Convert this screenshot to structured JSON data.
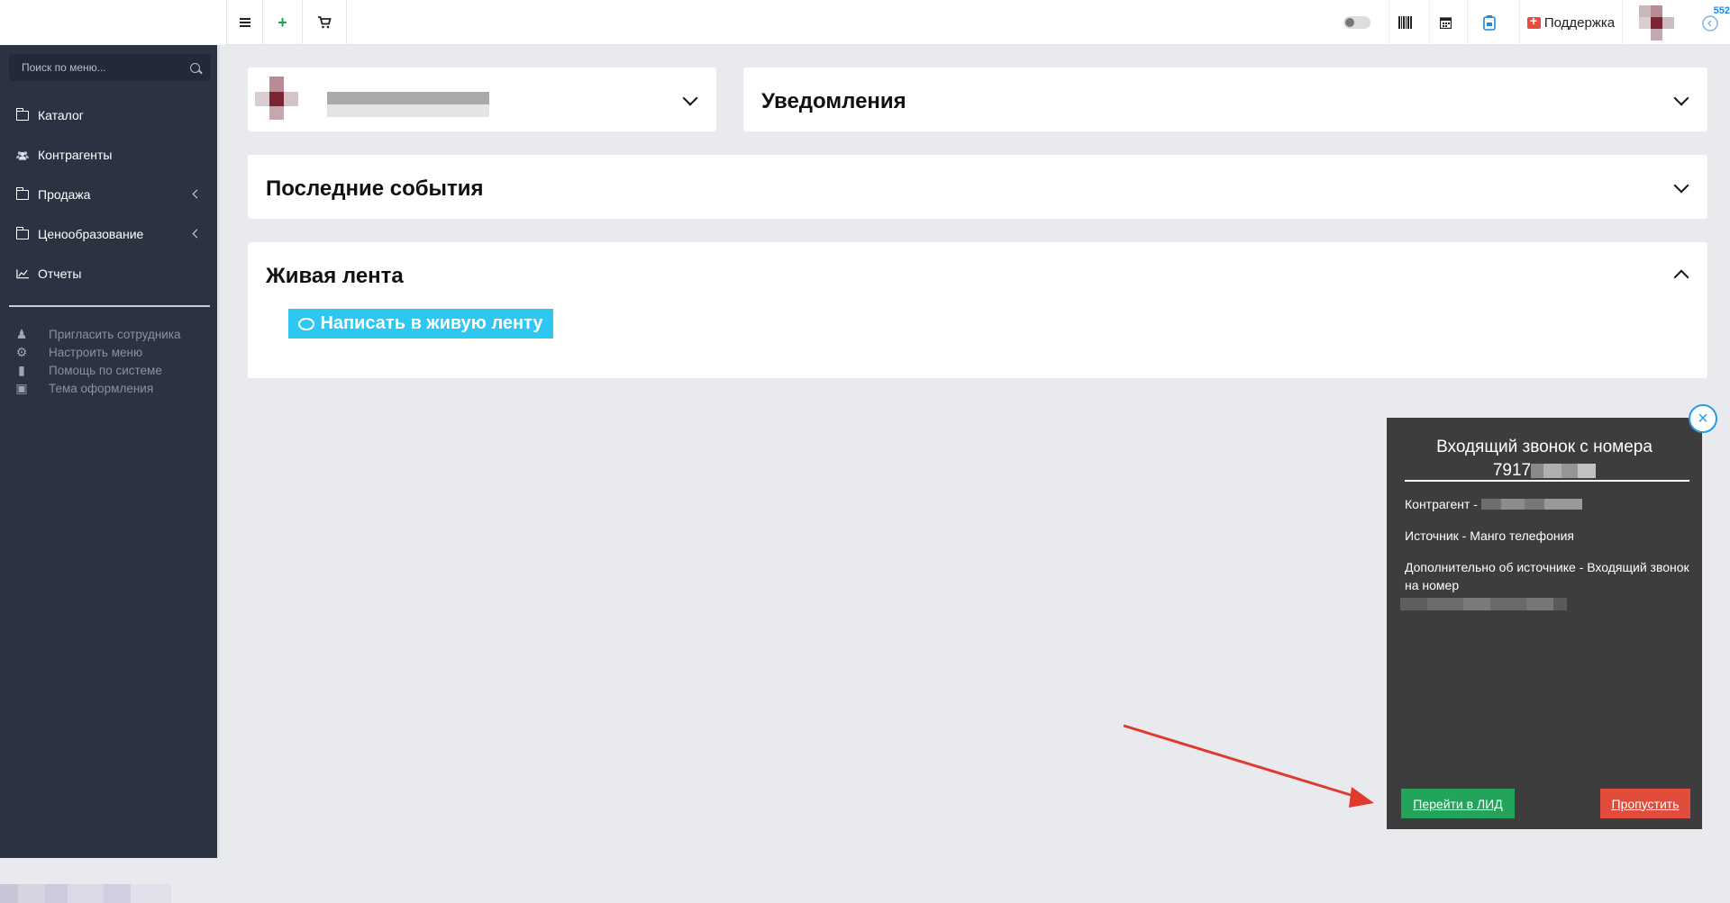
{
  "topbar": {
    "menu_icon": "hamburger-icon",
    "add_icon": "plus-icon",
    "cart_icon": "cart-icon",
    "support_label": "Поддержка",
    "badge_count": "552",
    "colors": {
      "add": "#1aa64a",
      "support_icon": "#e74c3c",
      "history": "#1e88e5"
    }
  },
  "sidebar": {
    "search_placeholder": "Поиск по меню...",
    "items": [
      {
        "label": "Каталог",
        "icon": "folder-icon"
      },
      {
        "label": "Контрагенты",
        "icon": "users-icon"
      },
      {
        "label": "Продажа",
        "icon": "folder-icon",
        "has_submenu": true
      },
      {
        "label": "Ценообразование",
        "icon": "folder-icon",
        "has_submenu": true
      },
      {
        "label": "Отчеты",
        "icon": "chart-line-icon"
      }
    ],
    "extra": [
      {
        "label": "Пригласить сотрудника",
        "icon": "user-plus-icon"
      },
      {
        "label": "Настроить меню",
        "icon": "gears-icon"
      },
      {
        "label": "Помощь по системе",
        "icon": "book-icon"
      },
      {
        "label": "Тема оформления",
        "icon": "image-icon"
      }
    ]
  },
  "panels": {
    "notifications_title": "Уведомления",
    "events_title": "Последние события",
    "feed_title": "Живая лента",
    "feed_button": "Написать в живую ленту"
  },
  "call_popup": {
    "title_line1": "Входящий звонок с номера",
    "number_prefix": "7917",
    "counterparty_label": "Контрагент -",
    "source": "Источник - Манго телефония",
    "source_extra": "Дополнительно об источнике - Входящий звонок на номер",
    "go_lead_button": "Перейти в ЛИД",
    "skip_button": "Пропустить",
    "colors": {
      "background": "#3d3d3d",
      "go": "#22a55a",
      "skip": "#e24c3c",
      "arrow": "#e03a2f"
    }
  }
}
